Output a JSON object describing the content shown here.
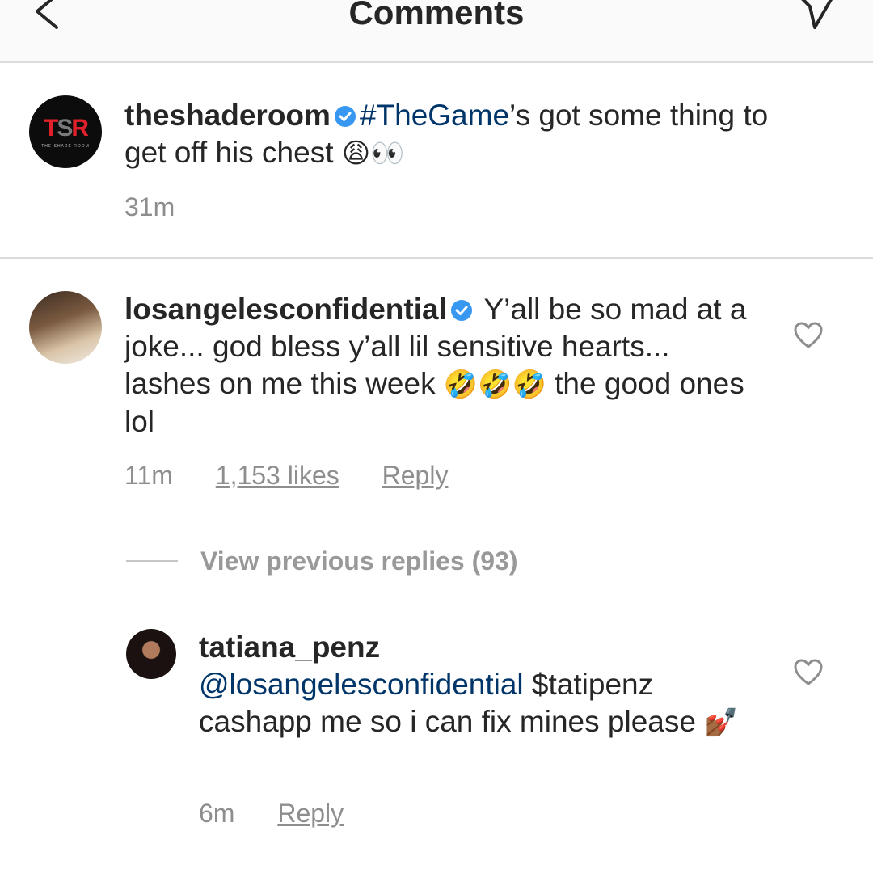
{
  "header": {
    "title": "Comments"
  },
  "caption": {
    "username": "theshaderoom",
    "avatar_text": "TSR",
    "avatar_sub": "THE SHADE ROOM",
    "hashtag": "#TheGame",
    "text_after": "’s got some thing to get off his chest",
    "emojis": "😩👀",
    "time": "31m"
  },
  "comment": {
    "username": "losangelesconfidential",
    "text_before": " Y’all be so mad at a joke... god bless y’all lil sensitive hearts... lashes on me this week ",
    "emojis": "🤣🤣🤣",
    "text_after": " the good ones lol",
    "time": "11m",
    "likes": "1,153 likes",
    "reply": "Reply"
  },
  "view_previous": "View previous replies (93)",
  "reply": {
    "username": "tatiana_penz",
    "mention": "@losangelesconfidential",
    "text": " $tatipenz cashapp me so i can fix mines please ",
    "emoji": "💅🏾",
    "time": "6m",
    "reply": "Reply"
  },
  "colors": {
    "link": "#003569",
    "verified": "#3897f0",
    "secondary": "#8e8e8e",
    "tsr_red": "#e0212b"
  }
}
